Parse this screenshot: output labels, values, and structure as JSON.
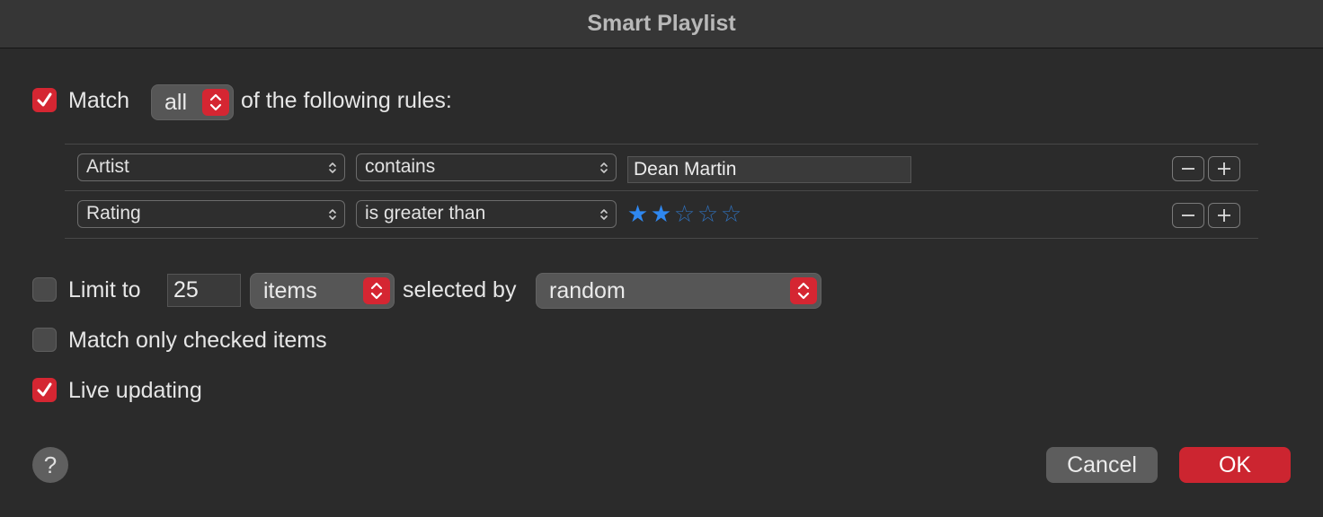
{
  "window": {
    "title": "Smart Playlist"
  },
  "match": {
    "checked": true,
    "label": "Match",
    "mode": "all",
    "suffix": "of the following rules:"
  },
  "rules": [
    {
      "field": "Artist",
      "operator": "contains",
      "value": "Dean Martin"
    },
    {
      "field": "Rating",
      "operator": "is greater than",
      "rating": 2,
      "rating_max": 5
    }
  ],
  "limit": {
    "checked": false,
    "label": "Limit to",
    "count": "25",
    "unit": "items",
    "selected_by_label": "selected by",
    "selected_by": "random"
  },
  "match_only_checked": {
    "checked": false,
    "label": "Match only checked items"
  },
  "live_updating": {
    "checked": true,
    "label": "Live updating"
  },
  "footer": {
    "help": "?",
    "cancel": "Cancel",
    "ok": "OK"
  },
  "colors": {
    "accent": "#d52632",
    "star": "#2f88f0",
    "background": "#2b2b2b"
  },
  "icons": {
    "checkbox_checked": "checkmark-icon",
    "popup_arrows": "up-down-chevron-icon",
    "remove": "minus-icon",
    "add": "plus-icon",
    "star": "star-icon"
  }
}
